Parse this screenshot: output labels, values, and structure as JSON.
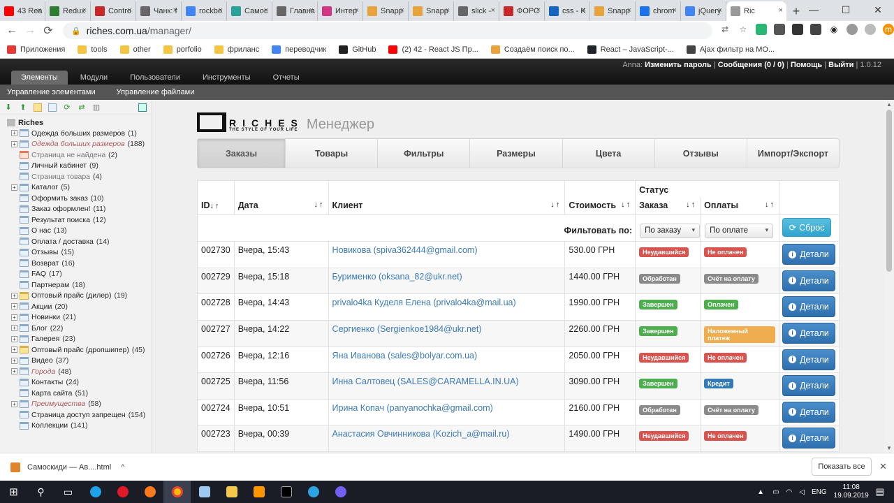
{
  "browser": {
    "tabs": [
      {
        "label": "43 Rea",
        "color": "#ff0000"
      },
      {
        "label": "Redux",
        "color": "#2e7d32"
      },
      {
        "label": "Contro",
        "color": "#c62828"
      },
      {
        "label": "Чанк: f",
        "color": "#666666"
      },
      {
        "label": "rockbo",
        "color": "#4285f4"
      },
      {
        "label": "Самос",
        "color": "#2aa198"
      },
      {
        "label": "Главна",
        "color": "#666666"
      },
      {
        "label": "Интер",
        "color": "#d33682"
      },
      {
        "label": "Snapp",
        "color": "#e8a33d"
      },
      {
        "label": "Snapp",
        "color": "#e8a33d"
      },
      {
        "label": "slick -",
        "color": "#666666"
      },
      {
        "label": "ФОРС",
        "color": "#c62828"
      },
      {
        "label": "css - K",
        "color": "#1565c0"
      },
      {
        "label": "Snapp",
        "color": "#e8a33d"
      },
      {
        "label": "chrom",
        "color": "#1a73e8"
      },
      {
        "label": "jQuery",
        "color": "#4285f4"
      }
    ],
    "active_tab": {
      "label": "Ric",
      "close": "×"
    },
    "new_tab": "+",
    "window_controls": {
      "minimize": "—",
      "maximize": "☐",
      "close": "✕"
    },
    "back": "←",
    "forward": "→",
    "reload": "⟳",
    "url_host": "riches.com.ua",
    "url_path": "/manager/",
    "bookmarks": [
      {
        "label": "Приложения",
        "color": "#e53935"
      },
      {
        "label": "tools",
        "color": "#f4c542"
      },
      {
        "label": "other",
        "color": "#f4c542"
      },
      {
        "label": "porfolio",
        "color": "#f4c542"
      },
      {
        "label": "фриланс",
        "color": "#f4c542"
      },
      {
        "label": "переводчик",
        "color": "#4285f4"
      },
      {
        "label": "GitHub",
        "color": "#222222"
      },
      {
        "label": "(2) 42 - React JS Пр...",
        "color": "#ff0000"
      },
      {
        "label": "Создаём поиск по...",
        "color": "#e8a33d"
      },
      {
        "label": "React – JavaScript-...",
        "color": "#20232a"
      },
      {
        "label": "Ajax фильтр на МО...",
        "color": "#444444"
      }
    ]
  },
  "cms": {
    "user_name": "Anna:",
    "change_password": "Изменить пароль",
    "messages": "Сообщения (0 / 0)",
    "help": "Помощь",
    "logout": "Выйти",
    "version": "1.0.12",
    "sep": "|",
    "nav": [
      "Элементы",
      "Модули",
      "Пользователи",
      "Инструменты",
      "Отчеты"
    ],
    "subnav": [
      "Управление элементами",
      "Управление файлами"
    ]
  },
  "tree": {
    "root": "Riches",
    "items": [
      {
        "label": "Одежда больших размеров",
        "count": "(1)",
        "exp": "+",
        "icon": "page",
        "style": ""
      },
      {
        "label": "Одежда больших размеров",
        "count": "(188)",
        "exp": "+",
        "icon": "page",
        "style": "italic"
      },
      {
        "label": "Страница не найдена",
        "count": "(2)",
        "exp": "",
        "icon": "red",
        "style": "gray"
      },
      {
        "label": "Личный кабинет",
        "count": "(9)",
        "exp": "",
        "icon": "page",
        "style": ""
      },
      {
        "label": "Страница товара",
        "count": "(4)",
        "exp": "",
        "icon": "page",
        "style": "gray"
      },
      {
        "label": "Каталог",
        "count": "(5)",
        "exp": "+",
        "icon": "page",
        "style": ""
      },
      {
        "label": "Оформить заказ",
        "count": "(10)",
        "exp": "",
        "icon": "page",
        "style": ""
      },
      {
        "label": "Заказ оформлен!",
        "count": "(11)",
        "exp": "",
        "icon": "page",
        "style": ""
      },
      {
        "label": "Результат поиска",
        "count": "(12)",
        "exp": "",
        "icon": "page",
        "style": ""
      },
      {
        "label": "О нас",
        "count": "(13)",
        "exp": "",
        "icon": "page",
        "style": ""
      },
      {
        "label": "Оплата / доставка",
        "count": "(14)",
        "exp": "",
        "icon": "page",
        "style": ""
      },
      {
        "label": "Отзывы",
        "count": "(15)",
        "exp": "",
        "icon": "page",
        "style": ""
      },
      {
        "label": "Возврат",
        "count": "(16)",
        "exp": "",
        "icon": "page",
        "style": ""
      },
      {
        "label": "FAQ",
        "count": "(17)",
        "exp": "",
        "icon": "page",
        "style": ""
      },
      {
        "label": "Партнерам",
        "count": "(18)",
        "exp": "",
        "icon": "page",
        "style": ""
      },
      {
        "label": "Оптовый прайс (дилер)",
        "count": "(19)",
        "exp": "+",
        "icon": "folder",
        "style": ""
      },
      {
        "label": "Акции",
        "count": "(20)",
        "exp": "+",
        "icon": "page",
        "style": ""
      },
      {
        "label": "Новинки",
        "count": "(21)",
        "exp": "+",
        "icon": "page",
        "style": ""
      },
      {
        "label": "Блог",
        "count": "(22)",
        "exp": "+",
        "icon": "page",
        "style": ""
      },
      {
        "label": "Галерея",
        "count": "(23)",
        "exp": "+",
        "icon": "page",
        "style": ""
      },
      {
        "label": "Оптовый прайс (дропшипер)",
        "count": "(45)",
        "exp": "+",
        "icon": "folder",
        "style": ""
      },
      {
        "label": "Видео",
        "count": "(37)",
        "exp": "+",
        "icon": "page",
        "style": ""
      },
      {
        "label": "Города",
        "count": "(48)",
        "exp": "+",
        "icon": "page",
        "style": "italic"
      },
      {
        "label": "Контакты",
        "count": "(24)",
        "exp": "",
        "icon": "page",
        "style": ""
      },
      {
        "label": "Карта сайта",
        "count": "(51)",
        "exp": "",
        "icon": "page",
        "style": ""
      },
      {
        "label": "Преимущества",
        "count": "(58)",
        "exp": "+",
        "icon": "page",
        "style": "italic"
      },
      {
        "label": "Страница доступ запрещен",
        "count": "(154)",
        "exp": "",
        "icon": "page",
        "style": ""
      },
      {
        "label": "Коллекции",
        "count": "(141)",
        "exp": "",
        "icon": "page",
        "style": ""
      }
    ]
  },
  "manager": {
    "logo_text": "RICHES",
    "logo_tagline": "THE STYLE OF YOUR LIFE",
    "logo_suffix": "Менеджер",
    "tabs": [
      "Заказы",
      "Товары",
      "Фильтры",
      "Размеры",
      "Цвета",
      "Отзывы",
      "Импорт/Экспорт"
    ],
    "table": {
      "status_header": "Статус",
      "headers": {
        "id": "ID",
        "date": "Дата",
        "client": "Клиент",
        "cost": "Стоимость",
        "order": "Заказа",
        "payment": "Оплаты"
      },
      "sort_arrows": "↓↑",
      "filter_label": "Фильтовать по:",
      "filter_order": "По заказу",
      "filter_payment": "По оплате",
      "reset": "Сброс",
      "details": "Детали",
      "rows": [
        {
          "id": "002730",
          "date": "Вчера, 15:43",
          "client": "Новикова (spiva362444@gmail.com)",
          "cost": "530.00 ГРН",
          "order_status": "Неудавшийся",
          "order_color": "#d9534f",
          "payment_status": "Не оплачен",
          "payment_color": "#d9534f"
        },
        {
          "id": "002729",
          "date": "Вчера, 15:18",
          "client": "Бурименко (oksana_82@ukr.net)",
          "cost": "1440.00 ГРН",
          "order_status": "Обработан",
          "order_color": "#8a8a8a",
          "payment_status": "Счёт на оплату",
          "payment_color": "#8a8a8a"
        },
        {
          "id": "002728",
          "date": "Вчера, 14:43",
          "client": "privalo4ka Куделя Елена (privalo4ka@mail.ua)",
          "cost": "1990.00 ГРН",
          "order_status": "Завершен",
          "order_color": "#4cae4c",
          "payment_status": "Оплачен",
          "payment_color": "#4cae4c"
        },
        {
          "id": "002727",
          "date": "Вчера, 14:22",
          "client": "Сергиенко (Sergienkoe1984@ukr.net)",
          "cost": "2260.00 ГРН",
          "order_status": "Завершен",
          "order_color": "#4cae4c",
          "payment_status": "Наложенный платеж",
          "payment_color": "#f0ad4e"
        },
        {
          "id": "002726",
          "date": "Вчера, 12:16",
          "client": "Яна Иванова (sales@bolyar.com.ua)",
          "cost": "2050.00 ГРН",
          "order_status": "Неудавшийся",
          "order_color": "#d9534f",
          "payment_status": "Не оплачен",
          "payment_color": "#d9534f"
        },
        {
          "id": "002725",
          "date": "Вчера, 11:56",
          "client": "Инна Салтовец (SALES@CARAMELLA.IN.UA)",
          "cost": "3090.00 ГРН",
          "order_status": "Завершен",
          "order_color": "#4cae4c",
          "payment_status": "Кредит",
          "payment_color": "#337ab7"
        },
        {
          "id": "002724",
          "date": "Вчера, 10:51",
          "client": "Ирина Копач (panyanochka@gmail.com)",
          "cost": "2160.00 ГРН",
          "order_status": "Обработан",
          "order_color": "#8a8a8a",
          "payment_status": "Счёт на оплату",
          "payment_color": "#8a8a8a"
        },
        {
          "id": "002723",
          "date": "Вчера, 00:39",
          "client": "Анастасия Овчинникова (Kozich_a@mail.ru)",
          "cost": "1490.00 ГРН",
          "order_status": "Неудавшийся",
          "order_color": "#d9534f",
          "payment_status": "Не оплачен",
          "payment_color": "#d9534f"
        }
      ]
    }
  },
  "download_bar": {
    "file": "Самоскиди — Ав....html",
    "chevron": "^",
    "show_all": "Показать все",
    "close": "✕"
  },
  "taskbar": {
    "lang": "ENG",
    "time": "11:08",
    "date": "19.09.2019"
  }
}
